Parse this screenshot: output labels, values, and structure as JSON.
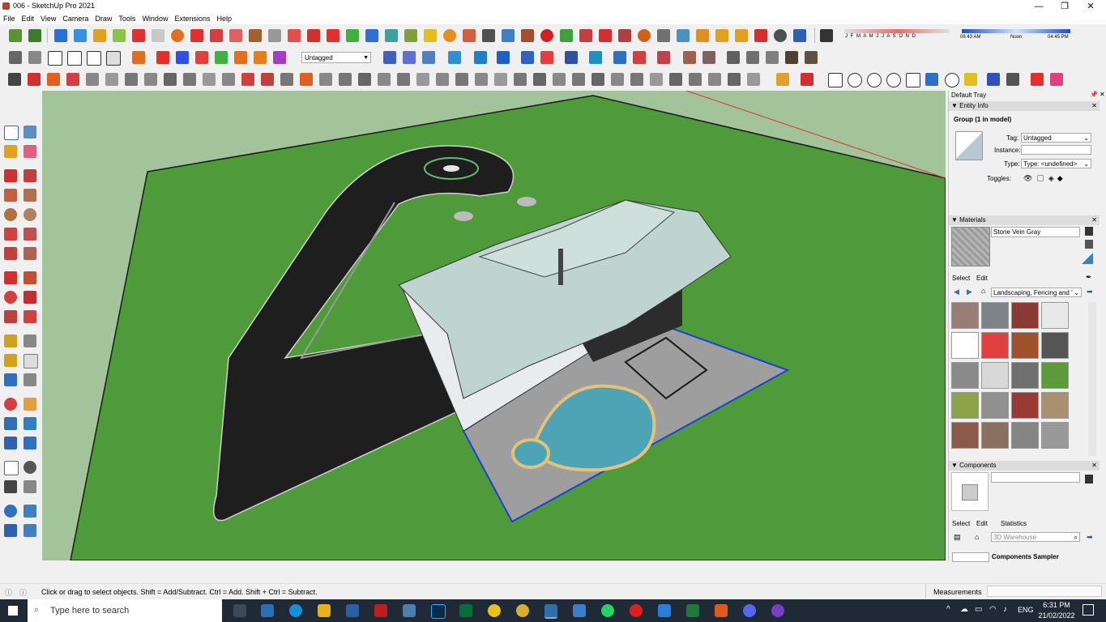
{
  "window": {
    "title": "006 - SketchUp Pro 2021",
    "minimize": "—",
    "maximize": "❐",
    "close": "✕"
  },
  "menu": [
    "File",
    "Edit",
    "View",
    "Camera",
    "Draw",
    "Tools",
    "Window",
    "Extensions",
    "Help"
  ],
  "shadow": {
    "months": "J F M A M J J A S O N D",
    "time_start": "06:43 AM",
    "time_mid": "Noon",
    "time_end": "04:45 PM"
  },
  "tag_dropdown": {
    "value": "Untagged"
  },
  "tray": {
    "title": "Default Tray",
    "entity_info": {
      "header": "Entity Info",
      "selection": "Group (1 in model)",
      "tag_label": "Tag:",
      "tag_value": "Untagged",
      "instance_label": "Instance:",
      "instance_value": "",
      "type_label": "Type:",
      "type_value": "Type: <undefined>",
      "toggles_label": "Toggles:"
    },
    "materials": {
      "header": "Materials",
      "name": "Stone Vein Gray",
      "tab_select": "Select",
      "tab_edit": "Edit",
      "collection": "Landscaping, Fencing and '",
      "swatch_colors": [
        "#9a7d76",
        "#7d8388",
        "#8a3a35",
        "#e8e8e8",
        "#ffffff",
        "#e04040",
        "#a0522d",
        "#555555",
        "#8a8a8a",
        "#d8d8d8",
        "#707070",
        "#5c9a3c",
        "#8da34a",
        "#909090",
        "#9b3a35",
        "#a89070",
        "#8c5a4a",
        "#8a7060",
        "#858585",
        "#999999"
      ]
    },
    "components": {
      "header": "Components",
      "tab_select": "Select",
      "tab_edit": "Edit",
      "tab_statistics": "Statistics",
      "search_placeholder": "3D Warehouse",
      "first_item": "Components Sampler"
    }
  },
  "status": {
    "message": "Click or drag to select objects. Shift = Add/Subtract. Ctrl = Add. Shift + Ctrl = Subtract.",
    "measurements_label": "Measurements",
    "measurements_value": ""
  },
  "taskbar": {
    "search_placeholder": "Type here to search",
    "lang": "ENG",
    "time": "6:31 PM",
    "date": "21/02/2022"
  }
}
